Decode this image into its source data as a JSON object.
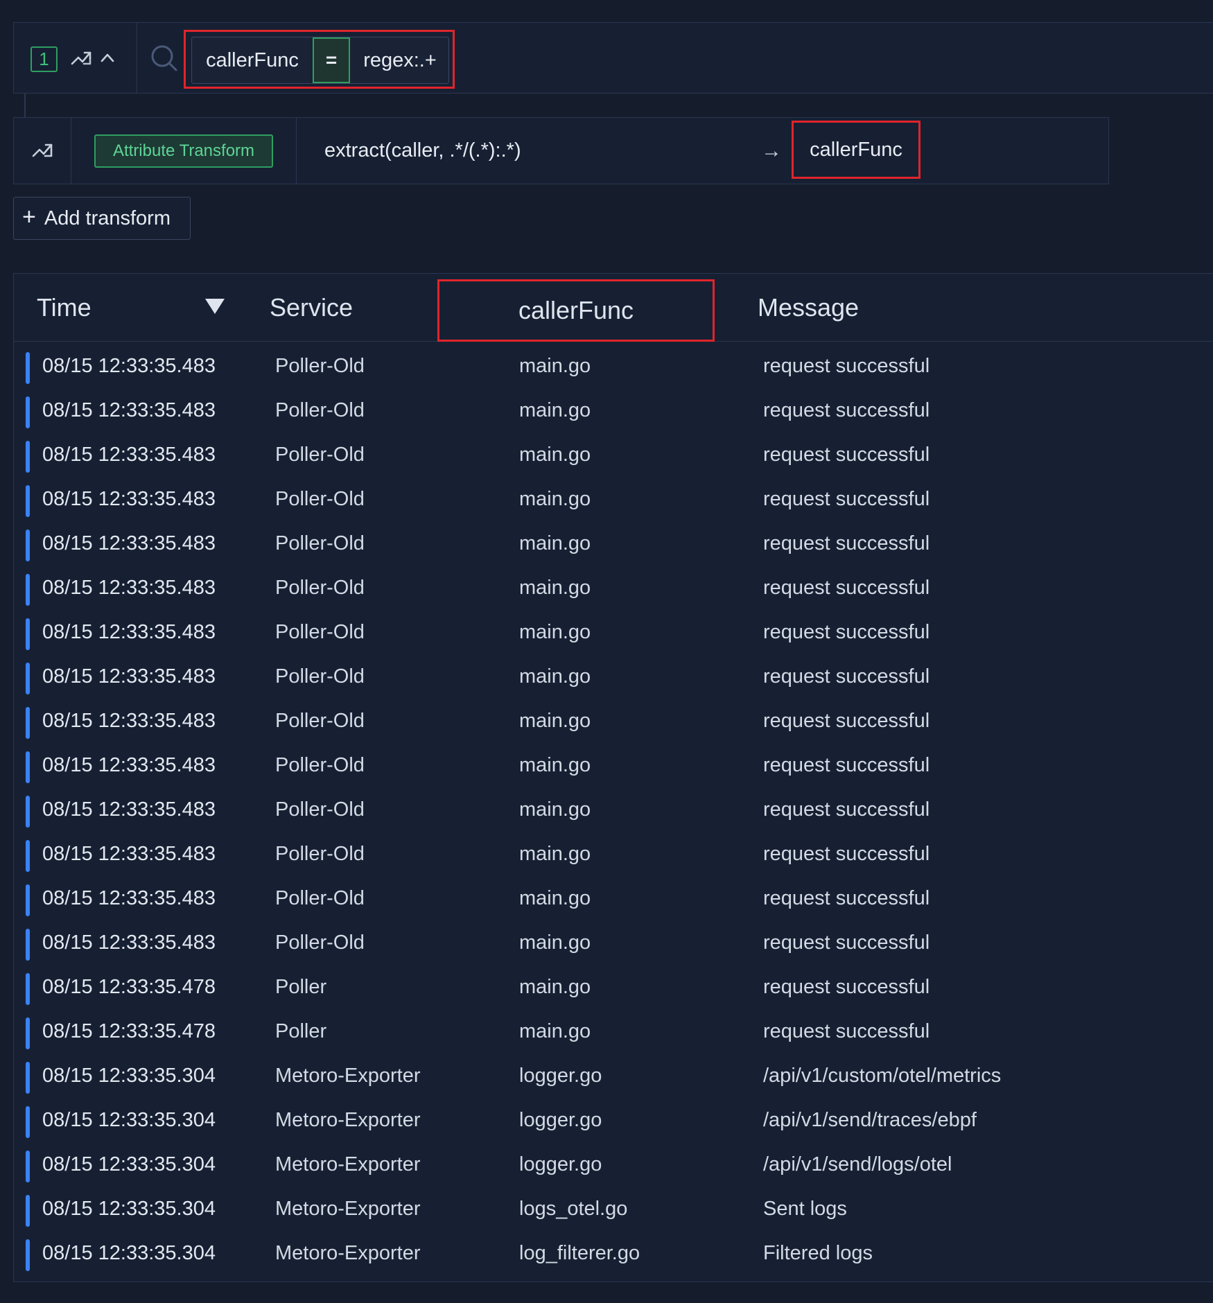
{
  "filter": {
    "count": "1",
    "key": "callerFunc",
    "operator": "=",
    "value": "regex:.+"
  },
  "transform": {
    "type_label": "Attribute Transform",
    "expression": "extract(caller, .*/(.*):.*)",
    "arrow": "→",
    "target": "callerFunc"
  },
  "add_transform": {
    "label": "Add transform"
  },
  "table": {
    "columns": [
      "Time",
      "Service",
      "callerFunc",
      "Message"
    ],
    "rows": [
      {
        "time": "08/15 12:33:35.483",
        "service": "Poller-Old",
        "caller": "main.go",
        "message": "request successful"
      },
      {
        "time": "08/15 12:33:35.483",
        "service": "Poller-Old",
        "caller": "main.go",
        "message": "request successful"
      },
      {
        "time": "08/15 12:33:35.483",
        "service": "Poller-Old",
        "caller": "main.go",
        "message": "request successful"
      },
      {
        "time": "08/15 12:33:35.483",
        "service": "Poller-Old",
        "caller": "main.go",
        "message": "request successful"
      },
      {
        "time": "08/15 12:33:35.483",
        "service": "Poller-Old",
        "caller": "main.go",
        "message": "request successful"
      },
      {
        "time": "08/15 12:33:35.483",
        "service": "Poller-Old",
        "caller": "main.go",
        "message": "request successful"
      },
      {
        "time": "08/15 12:33:35.483",
        "service": "Poller-Old",
        "caller": "main.go",
        "message": "request successful"
      },
      {
        "time": "08/15 12:33:35.483",
        "service": "Poller-Old",
        "caller": "main.go",
        "message": "request successful"
      },
      {
        "time": "08/15 12:33:35.483",
        "service": "Poller-Old",
        "caller": "main.go",
        "message": "request successful"
      },
      {
        "time": "08/15 12:33:35.483",
        "service": "Poller-Old",
        "caller": "main.go",
        "message": "request successful"
      },
      {
        "time": "08/15 12:33:35.483",
        "service": "Poller-Old",
        "caller": "main.go",
        "message": "request successful"
      },
      {
        "time": "08/15 12:33:35.483",
        "service": "Poller-Old",
        "caller": "main.go",
        "message": "request successful"
      },
      {
        "time": "08/15 12:33:35.483",
        "service": "Poller-Old",
        "caller": "main.go",
        "message": "request successful"
      },
      {
        "time": "08/15 12:33:35.483",
        "service": "Poller-Old",
        "caller": "main.go",
        "message": "request successful"
      },
      {
        "time": "08/15 12:33:35.478",
        "service": "Poller",
        "caller": "main.go",
        "message": "request successful"
      },
      {
        "time": "08/15 12:33:35.478",
        "service": "Poller",
        "caller": "main.go",
        "message": "request successful"
      },
      {
        "time": "08/15 12:33:35.304",
        "service": "Metoro-Exporter",
        "caller": "logger.go",
        "message": "/api/v1/custom/otel/metrics"
      },
      {
        "time": "08/15 12:33:35.304",
        "service": "Metoro-Exporter",
        "caller": "logger.go",
        "message": "/api/v1/send/traces/ebpf"
      },
      {
        "time": "08/15 12:33:35.304",
        "service": "Metoro-Exporter",
        "caller": "logger.go",
        "message": "/api/v1/send/logs/otel"
      },
      {
        "time": "08/15 12:33:35.304",
        "service": "Metoro-Exporter",
        "caller": "logs_otel.go",
        "message": "Sent logs"
      },
      {
        "time": "08/15 12:33:35.304",
        "service": "Metoro-Exporter",
        "caller": "log_filterer.go",
        "message": "Filtered logs"
      }
    ]
  },
  "colors": {
    "background": "#151d2c",
    "panel": "#172033",
    "accent_green": "#2f9e60",
    "highlight_red": "#e0252b",
    "row_marker_blue": "#3b82f6"
  }
}
